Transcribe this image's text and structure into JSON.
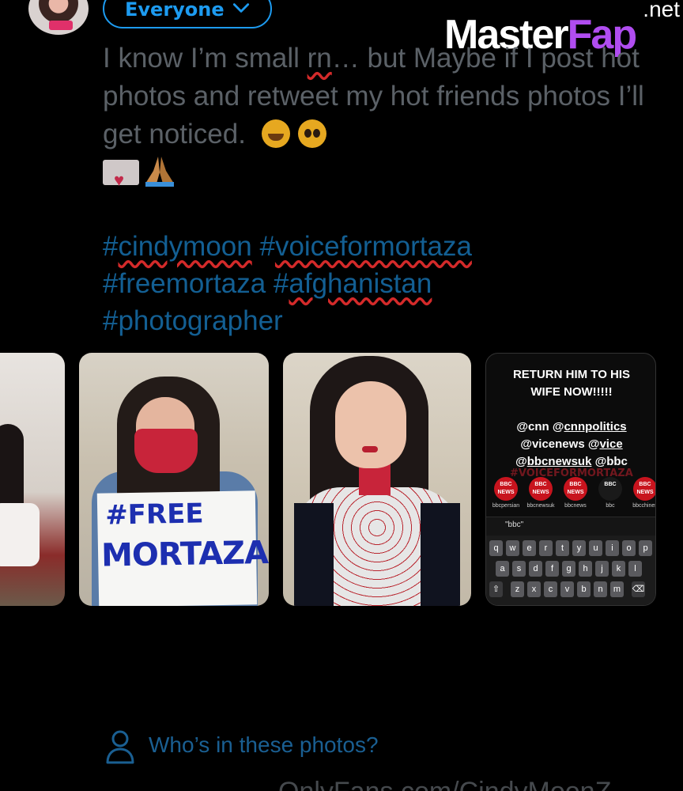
{
  "header": {
    "audience_label": "Everyone"
  },
  "watermark": {
    "brand_main": "Master",
    "brand_accent": "Fap",
    "brand_tld": ".net"
  },
  "compose": {
    "text_part1": "I know I’m small ",
    "text_misspelled": "rn",
    "text_part2": "… but Maybe if I post hot photos and retweet my hot friends photos I’ll get noticed.",
    "hashtags": [
      {
        "text": "#",
        "underlined": false
      },
      {
        "text": "cindymoon",
        "underlined": true
      },
      {
        "text": " #",
        "underlined": false
      },
      {
        "text": "voiceformortaza",
        "underlined": true
      },
      {
        "text": " #freemortaza #",
        "underlined": false
      },
      {
        "text": "afghanistan",
        "underlined": true
      },
      {
        "text": " #photographer",
        "underlined": false
      }
    ],
    "hashtag_full": "#cindymoon #voiceformortaza #freemortaza #afghanistan #photographer"
  },
  "media": {
    "sign_line_1": "#FREE",
    "sign_line_2": "MORTAZA",
    "screenshot": {
      "headline_1": "RETURN HIM TO HIS",
      "headline_2": "WIFE NOW!!!!!",
      "mention_line_1_a": "@cnn @",
      "mention_line_1_b": "cnnpolitics",
      "mention_line_2_a": "@vicenews @",
      "mention_line_2_b": "vice",
      "mention_line_3_a": "@",
      "mention_line_3_b": "bbcnewsuk",
      "mention_line_3_c": " @bbc",
      "overlay_tag": "#VOICEFORMORTAZA",
      "accounts": [
        {
          "logo": "BBC NEWS",
          "label": "bbcpersian"
        },
        {
          "logo": "BBC NEWS",
          "label": "bbcnewsuk"
        },
        {
          "logo": "BBC NEWS",
          "label": "bbcnews"
        },
        {
          "logo": "BBC",
          "label": "bbc"
        },
        {
          "logo": "BBC NEWS",
          "label": "bbcchines"
        }
      ],
      "suggestion": "\"bbc\"",
      "keyboard_rows": [
        [
          "q",
          "w",
          "e",
          "r",
          "t",
          "y",
          "u",
          "i",
          "o",
          "p"
        ],
        [
          "a",
          "s",
          "d",
          "f",
          "g",
          "h",
          "j",
          "k",
          "l"
        ],
        [
          "⇧",
          "z",
          "x",
          "c",
          "v",
          "b",
          "n",
          "m",
          "⌫"
        ]
      ]
    }
  },
  "footer": {
    "who_label": "Who’s in these photos?",
    "bottom_partial": "OnlyFans.com/CindyMoonZ"
  }
}
